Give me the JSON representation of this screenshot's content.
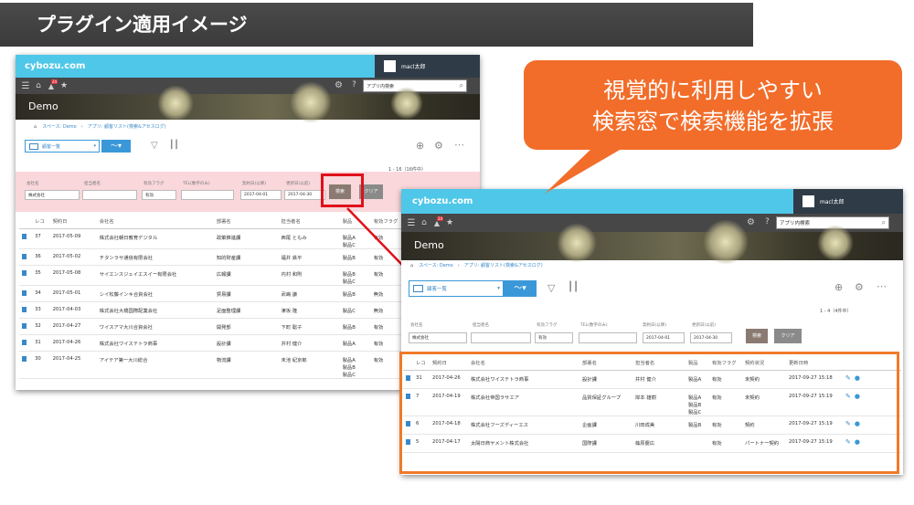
{
  "slide_title": "プラグイン適用イメージ",
  "callout": {
    "line1": "視覚的に利用しやすい",
    "line2": "検索窓で検索機能を拡張"
  },
  "colors": {
    "header": "#4fc7e8",
    "callout": "#f26d2a",
    "highlight_red": "#e0101a",
    "highlight_orange": "#f07a2a",
    "search_area_before": "#f9d7da"
  },
  "icons": [
    "menu-icon",
    "home-icon",
    "bell-icon",
    "star-icon",
    "gear-icon",
    "help-icon",
    "search-icon",
    "filter-icon",
    "chart-icon",
    "plus-icon",
    "more-icon",
    "document-icon",
    "edit-icon",
    "delete-icon"
  ],
  "before": {
    "logo": "cybozu.com",
    "user": "macl太郎",
    "search_placeholder": "アプリ内検索",
    "notification_count": "24",
    "app_name": "Demo",
    "breadcrumb": "スペース: Demo　›　アプリ: 顧客リスト(検索&アセスログ)",
    "view": "顧客一覧",
    "paging": "1 - 16（16件中）",
    "labels": [
      "会社名",
      "担当者名",
      "有効フラグ",
      "TEL(数字のみ)",
      "契約日(以降)",
      "更新日(以前)"
    ],
    "values": [
      "株式会社",
      "",
      "有効",
      "",
      "2017-04-01",
      "2017-04-30"
    ],
    "search_btn": "検索",
    "clear_btn": "クリア",
    "columns": [
      "レコ",
      "契約日",
      "会社名",
      "部署名",
      "担当者名",
      "製品",
      "有効フラグ",
      "契約状況",
      "更"
    ],
    "rows": [
      [
        "37",
        "2017-05-09",
        "株式会社朝日教育デジタル",
        "政策推進課",
        "西尾 ともみ",
        "製品A 製品C",
        "有効",
        "パートナー",
        ""
      ],
      [
        "36",
        "2017-05-02",
        "チタンラサ通信有限会社",
        "知的財産課",
        "福井 鉄平",
        "製品B",
        "有効",
        "未契約",
        ""
      ],
      [
        "35",
        "2017-05-08",
        "サイエンスジェイエスイー有限会社",
        "広報課",
        "内村 和則",
        "製品B 製品C",
        "有効",
        "契約",
        ""
      ],
      [
        "34",
        "2017-05-01",
        "シイ松藤インキ合資会社",
        "貿易課",
        "武嶋 謙",
        "製品B",
        "無効",
        "未契約",
        ""
      ],
      [
        "33",
        "2017-04-03",
        "株式会社大橋国際配業会社",
        "足面整理課",
        "津坂 隆",
        "製品C",
        "無効",
        "未契約",
        ""
      ],
      [
        "32",
        "2017-04-27",
        "ワイスアマ大川合資会社",
        "開発部",
        "下町 聡子",
        "製品B",
        "有効",
        "契約",
        ""
      ],
      [
        "31",
        "2017-04-26",
        "株式会社ワイステトラ商事",
        "設計課",
        "井村 健介",
        "製品A",
        "有効",
        "未契約",
        ""
      ],
      [
        "30",
        "2017-04-25",
        "アイテア第一大川総合",
        "物流課",
        "末池 紀京郎",
        "製品A 製品B 製品C",
        "有効",
        "契約",
        ""
      ]
    ]
  },
  "after": {
    "logo": "cybozu.com",
    "user": "macl太郎",
    "search_placeholder": "アプリ内検索",
    "notification_count": "24",
    "app_name": "Demo",
    "breadcrumb": "スペース: Demo　›　アプリ: 顧客リスト(検索&アセスログ)",
    "view": "顧客一覧",
    "paging": "1 - 4（4件中）",
    "labels": [
      "会社名",
      "担当者名",
      "有効フラグ",
      "TEL(数字のみ)",
      "契約日(以降)",
      "更新日(以前)"
    ],
    "values": [
      "株式会社",
      "",
      "有効",
      "",
      "2017-04-01",
      "2017-04-30"
    ],
    "search_btn": "検索",
    "clear_btn": "クリア",
    "columns": [
      "レコ",
      "契約日",
      "会社名",
      "部署名",
      "担当者名",
      "製品",
      "有効フラグ",
      "契約状況",
      "更新日時"
    ],
    "rows": [
      [
        "31",
        "2017-04-26",
        "株式会社ワイステトラ商事",
        "設計課",
        "井村 健介",
        "製品A",
        "有効",
        "未契約",
        "2017-09-27 15:18"
      ],
      [
        "7",
        "2017-04-19",
        "株式会社帝国ラサエア",
        "品質保証グループ",
        "岸本 雄樹",
        "製品A 製品B 製品C",
        "有効",
        "未契約",
        "2017-09-27 15:19"
      ],
      [
        "6",
        "2017-04-18",
        "株式会社フーズディーエス",
        "企画課",
        "川田成美",
        "製品B",
        "有効",
        "契約",
        "2017-09-27 15:19"
      ],
      [
        "5",
        "2017-04-17",
        "太陽日商ヤメント株式会社",
        "国際課",
        "篠原慶広",
        "",
        "有効",
        "パートナー契約",
        "2017-09-27 15:19"
      ]
    ]
  }
}
